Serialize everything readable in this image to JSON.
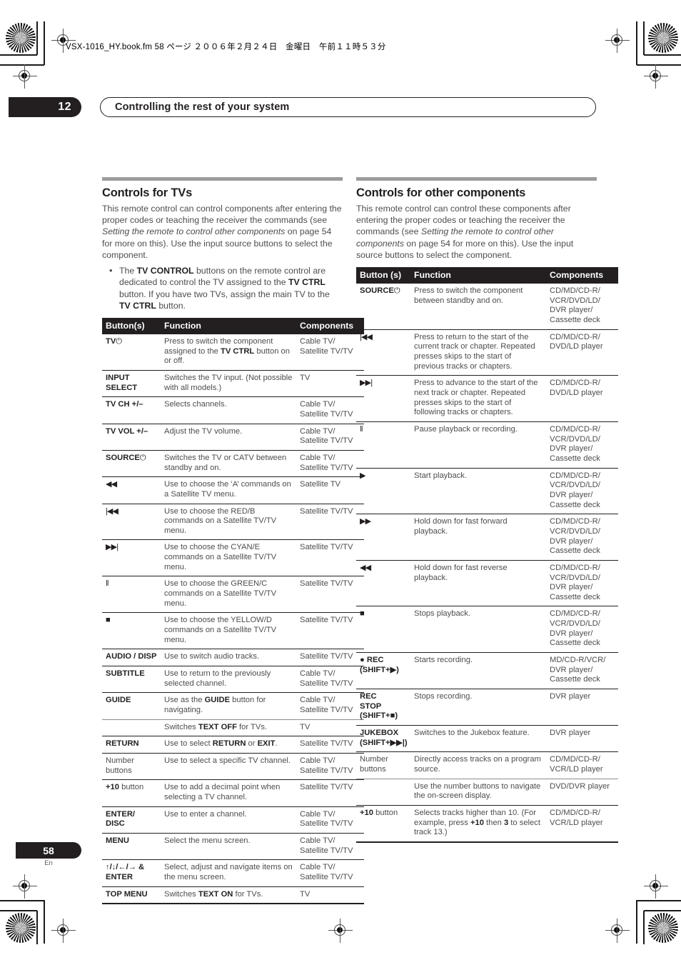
{
  "print_marks": {
    "file_info": "VSX-1016_HY.book.fm 58 ページ ２００６年２月２４日　金曜日　午前１１時５３分"
  },
  "header": {
    "chapter_number": "12",
    "chapter_title": "Controlling the rest of your system"
  },
  "footer": {
    "page_number": "58",
    "language_code": "En"
  },
  "left_column": {
    "section_title": "Controls for TVs",
    "intro_1": "This remote control can control components after entering the proper codes or teaching the receiver the commands (see ",
    "intro_italic": "Setting the remote to control other components",
    "intro_2": " on page 54 for more on this). Use the input source buttons to select the component.",
    "bullet_1_a": "The ",
    "bullet_1_b": "TV CONTROL",
    "bullet_1_c": " buttons on the remote control are dedicated to control the TV assigned to the ",
    "bullet_1_d": "TV CTRL",
    "bullet_1_e": " button. If you have two TVs, assign the main TV to the ",
    "bullet_1_f": "TV CTRL",
    "bullet_1_g": " button.",
    "table": {
      "headers": [
        "Button(s)",
        "Function",
        "Components"
      ],
      "rows": [
        {
          "button": "TV",
          "button_glyph": "⏻",
          "function": "Press to switch the component assigned to the TV CTRL button on or off.",
          "function_bold": "TV CTRL",
          "components": "Cable TV/ Satellite TV/TV"
        },
        {
          "button": "INPUT SELECT",
          "function": "Switches the TV input. (Not possible with all models.)",
          "components": "TV"
        },
        {
          "button": "TV CH +/–",
          "function": "Selects channels.",
          "components": "Cable TV/ Satellite TV/TV"
        },
        {
          "button": "TV VOL +/–",
          "function": "Adjust the TV volume.",
          "components": "Cable TV/ Satellite TV/TV"
        },
        {
          "button": "SOURCE",
          "button_glyph": "⏻",
          "function": "Switches the TV or CATV between standby and on.",
          "components": "Cable TV/ Satellite TV/TV"
        },
        {
          "button": "◀◀",
          "button_is_glyph": true,
          "function": "Use to choose the ‘A’ commands on a Satellite TV menu.",
          "components": "Satellite TV"
        },
        {
          "button": "|◀◀",
          "button_is_glyph": true,
          "function": "Use to choose the RED/B commands on a Satellite TV/TV menu.",
          "components": "Satellite TV/TV"
        },
        {
          "button": "▶▶|",
          "button_is_glyph": true,
          "function": "Use to choose the CYAN/E commands on a Satellite TV/TV menu.",
          "components": "Satellite TV/TV"
        },
        {
          "button": "‖",
          "button_is_glyph": true,
          "function": "Use to choose the GREEN/C commands on a Satellite TV/TV menu.",
          "components": "Satellite TV/TV"
        },
        {
          "button": "■",
          "button_is_glyph": true,
          "function": "Use to choose the YELLOW/D commands on a Satellite TV/TV menu.",
          "components": "Satellite TV/TV"
        },
        {
          "button": "AUDIO / DISP",
          "function": "Use to switch audio tracks.",
          "components": "Satellite TV/TV"
        },
        {
          "button": "SUBTITLE",
          "function": "Use to return to the previously selected channel.",
          "components": "Cable TV/ Satellite TV/TV"
        },
        {
          "button": "GUIDE",
          "function": "Use as the GUIDE button for navigating.",
          "function_bold": "GUIDE",
          "components": "Cable TV/ Satellite TV/TV"
        },
        {
          "button": "",
          "function": "Switches TEXT OFF for TVs.",
          "function_bold": "TEXT OFF",
          "components": "TV",
          "is_sub": true
        },
        {
          "button": "RETURN",
          "function": "Use to select RETURN or EXIT.",
          "components": "Satellite TV/TV"
        },
        {
          "button": "Number buttons",
          "button_light": true,
          "function": "Use to select a specific TV channel.",
          "components": "Cable TV/ Satellite TV/TV"
        },
        {
          "button": "+10 button",
          "function": "Use to add a decimal point when selecting a TV channel.",
          "components": "Satellite TV/TV"
        },
        {
          "button": "ENTER/ DISC",
          "function": "Use to enter a channel.",
          "components": "Cable TV/ Satellite TV/TV"
        },
        {
          "button": "MENU",
          "function": "Select the menu screen.",
          "components": "Cable TV/ Satellite TV/TV"
        },
        {
          "button": "↑/↓/←/→ & ENTER",
          "function": "Select, adjust and navigate items on the menu screen.",
          "components": "Cable TV/ Satellite TV/TV"
        },
        {
          "button": "TOP MENU",
          "function": "Switches TEXT ON for TVs.",
          "function_bold": "TEXT ON",
          "components": "TV"
        }
      ]
    }
  },
  "right_column": {
    "section_title": "Controls for other components",
    "intro_1": "This remote control can control these components after entering the proper codes or teaching the receiver the commands (see ",
    "intro_italic": "Setting the remote to control other components",
    "intro_2": " on page 54 for more on this). Use the input source buttons to select the component.",
    "table": {
      "headers": [
        "Button (s)",
        "Function",
        "Components"
      ],
      "rows": [
        {
          "button": "SOURCE",
          "button_glyph": "⏻",
          "function": "Press to switch the component between standby and on.",
          "components": "CD/MD/CD-R/ VCR/DVD/LD/ DVR player/ Cassette deck"
        },
        {
          "button": "|◀◀",
          "button_is_glyph": true,
          "function": "Press to return to the start of the current track or chapter. Repeated presses skips to the start of previous tracks or chapters.",
          "components": "CD/MD/CD-R/ DVD/LD player"
        },
        {
          "button": "▶▶|",
          "button_is_glyph": true,
          "function": "Press to advance to the start of the next track or chapter. Repeated presses skips to the start of following tracks or chapters.",
          "components": "CD/MD/CD-R/ DVD/LD player"
        },
        {
          "button": "‖",
          "button_is_glyph": true,
          "function": "Pause playback or recording.",
          "components": "CD/MD/CD-R/ VCR/DVD/LD/ DVR player/ Cassette deck"
        },
        {
          "button": "▶",
          "button_is_glyph": true,
          "function": "Start playback.",
          "components": "CD/MD/CD-R/ VCR/DVD/LD/ DVR player/ Cassette deck"
        },
        {
          "button": "▶▶",
          "button_is_glyph": true,
          "function": "Hold down for fast forward playback.",
          "components": "CD/MD/CD-R/ VCR/DVD/LD/ DVR player/ Cassette deck"
        },
        {
          "button": "◀◀",
          "button_is_glyph": true,
          "function": "Hold down for fast reverse playback.",
          "components": "CD/MD/CD-R/ VCR/DVD/LD/ DVR player/ Cassette deck"
        },
        {
          "button": "■",
          "button_is_glyph": true,
          "function": "Stops playback.",
          "components": "CD/MD/CD-R/ VCR/DVD/LD/ DVR player/ Cassette deck"
        },
        {
          "button": "● REC (SHIFT+▶)",
          "function": "Starts recording.",
          "components": "MD/CD-R/VCR/ DVR player/ Cassette deck"
        },
        {
          "button": "REC STOP (SHIFT+■)",
          "function": "Stops recording.",
          "components": "DVR player"
        },
        {
          "button": "JUKEBOX (SHIFT+▶▶|)",
          "function": "Switches to the Jukebox feature.",
          "components": "DVR player"
        },
        {
          "button": "Number buttons",
          "button_light": true,
          "function": "Directly access tracks on a program source.",
          "components": "CD/MD/CD-R/ VCR/LD player"
        },
        {
          "button": "",
          "function": "Use the number buttons to navigate the on-screen display.",
          "components": "DVD/DVR player",
          "is_sub": true
        },
        {
          "button": "+10 button",
          "function": "Selects tracks higher than 10. (For example, press +10 then 3 to select track 13.)",
          "components": "CD/MD/CD-R/ VCR/LD player"
        }
      ]
    }
  }
}
